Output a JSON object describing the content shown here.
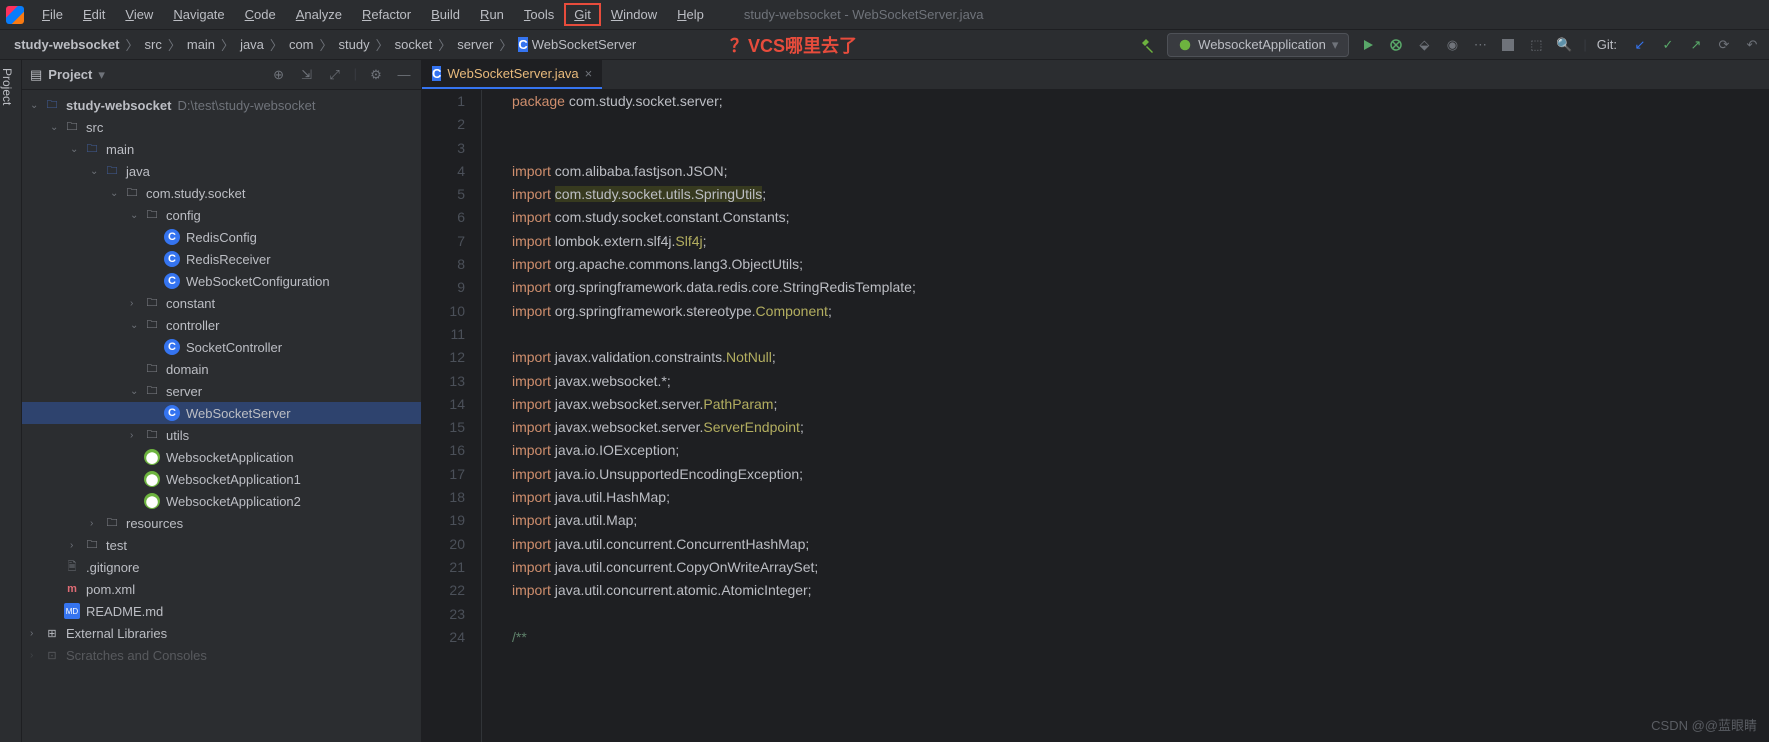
{
  "window": {
    "title": "study-websocket - WebSocketServer.java"
  },
  "menu": [
    "File",
    "Edit",
    "View",
    "Navigate",
    "Code",
    "Analyze",
    "Refactor",
    "Build",
    "Run",
    "Tools",
    "Git",
    "Window",
    "Help"
  ],
  "annotation": "？VCS哪里去了",
  "breadcrumb": [
    "study-websocket",
    "src",
    "main",
    "java",
    "com",
    "study",
    "socket",
    "server",
    "WebSocketServer"
  ],
  "run_config": "WebsocketApplication",
  "git_label": "Git:",
  "panel": {
    "title": "Project",
    "tools": [
      "target-icon",
      "expand-icon",
      "divide-icon",
      "gear-icon",
      "hide-icon"
    ]
  },
  "tree": [
    {
      "d": 0,
      "a": "v",
      "i": "folder-blue",
      "t": "study-websocket",
      "hint": "D:\\test\\study-websocket",
      "bold": true
    },
    {
      "d": 1,
      "a": "v",
      "i": "folder",
      "t": "src"
    },
    {
      "d": 2,
      "a": "v",
      "i": "folder-blue",
      "t": "main"
    },
    {
      "d": 3,
      "a": "v",
      "i": "folder-blue",
      "t": "java"
    },
    {
      "d": 4,
      "a": "v",
      "i": "folder",
      "t": "com.study.socket"
    },
    {
      "d": 5,
      "a": "v",
      "i": "folder",
      "t": "config"
    },
    {
      "d": 6,
      "a": "",
      "i": "class",
      "t": "RedisConfig"
    },
    {
      "d": 6,
      "a": "",
      "i": "class",
      "t": "RedisReceiver"
    },
    {
      "d": 6,
      "a": "",
      "i": "class",
      "t": "WebSocketConfiguration"
    },
    {
      "d": 5,
      "a": ">",
      "i": "folder",
      "t": "constant"
    },
    {
      "d": 5,
      "a": "v",
      "i": "folder",
      "t": "controller"
    },
    {
      "d": 6,
      "a": "",
      "i": "class",
      "t": "SocketController"
    },
    {
      "d": 5,
      "a": "",
      "i": "folder",
      "t": "domain"
    },
    {
      "d": 5,
      "a": "v",
      "i": "folder",
      "t": "server"
    },
    {
      "d": 6,
      "a": "",
      "i": "class",
      "t": "WebSocketServer",
      "sel": true
    },
    {
      "d": 5,
      "a": ">",
      "i": "folder",
      "t": "utils"
    },
    {
      "d": 5,
      "a": "",
      "i": "spring",
      "t": "WebsocketApplication"
    },
    {
      "d": 5,
      "a": "",
      "i": "spring",
      "t": "WebsocketApplication1"
    },
    {
      "d": 5,
      "a": "",
      "i": "spring",
      "t": "WebsocketApplication2"
    },
    {
      "d": 3,
      "a": ">",
      "i": "folder",
      "t": "resources"
    },
    {
      "d": 2,
      "a": ">",
      "i": "folder",
      "t": "test"
    },
    {
      "d": 1,
      "a": "",
      "i": "file",
      "t": ".gitignore"
    },
    {
      "d": 1,
      "a": "",
      "i": "maven",
      "t": "pom.xml"
    },
    {
      "d": 1,
      "a": "",
      "i": "md",
      "t": "README.md"
    },
    {
      "d": 0,
      "a": ">",
      "i": "lib",
      "t": "External Libraries"
    },
    {
      "d": 0,
      "a": ">",
      "i": "scratch",
      "t": "Scratches and Consoles",
      "cut": true
    }
  ],
  "tab": {
    "name": "WebSocketServer.java"
  },
  "code": [
    {
      "n": 1,
      "h": "<span class='kw'>package</span> com.study.socket.server;"
    },
    {
      "n": 2,
      "h": ""
    },
    {
      "n": 3,
      "h": ""
    },
    {
      "n": 4,
      "h": "<span class='kw'>import</span> com.alibaba.fastjson.JSON;"
    },
    {
      "n": 5,
      "h": "<span class='kw'>import</span> <span class='sel-imp'>com.study.socket.utils.SpringUtils</span>;"
    },
    {
      "n": 6,
      "h": "<span class='kw'>import</span> com.study.socket.constant.Constants;"
    },
    {
      "n": 7,
      "h": "<span class='kw'>import</span> lombok.extern.slf4j.<span class='ann'>Slf4j</span>;"
    },
    {
      "n": 8,
      "h": "<span class='kw'>import</span> org.apache.commons.lang3.ObjectUtils;"
    },
    {
      "n": 9,
      "h": "<span class='kw'>import</span> org.springframework.data.redis.core.StringRedisTemplate;"
    },
    {
      "n": 10,
      "h": "<span class='kw'>import</span> org.springframework.stereotype.<span class='ann'>Component</span>;"
    },
    {
      "n": 11,
      "h": ""
    },
    {
      "n": 12,
      "h": "<span class='kw'>import</span> javax.validation.constraints.<span class='ann'>NotNull</span>;"
    },
    {
      "n": 13,
      "h": "<span class='kw'>import</span> javax.websocket.*;"
    },
    {
      "n": 14,
      "h": "<span class='kw'>import</span> javax.websocket.server.<span class='ann'>PathParam</span>;"
    },
    {
      "n": 15,
      "h": "<span class='kw'>import</span> javax.websocket.server.<span class='ann'>ServerEndpoint</span>;"
    },
    {
      "n": 16,
      "h": "<span class='kw'>import</span> java.io.IOException;"
    },
    {
      "n": 17,
      "h": "<span class='kw'>import</span> java.io.UnsupportedEncodingException;"
    },
    {
      "n": 18,
      "h": "<span class='kw'>import</span> java.util.HashMap;"
    },
    {
      "n": 19,
      "h": "<span class='kw'>import</span> java.util.Map;"
    },
    {
      "n": 20,
      "h": "<span class='kw'>import</span> java.util.concurrent.ConcurrentHashMap;"
    },
    {
      "n": 21,
      "h": "<span class='kw'>import</span> java.util.concurrent.CopyOnWriteArraySet;"
    },
    {
      "n": 22,
      "h": "<span class='kw'>import</span> java.util.concurrent.atomic.AtomicInteger;"
    },
    {
      "n": 23,
      "h": ""
    },
    {
      "n": 24,
      "h": "<span style='color:#5f826b'>/**</span>"
    }
  ],
  "watermark": "CSDN @@蓝眼睛"
}
